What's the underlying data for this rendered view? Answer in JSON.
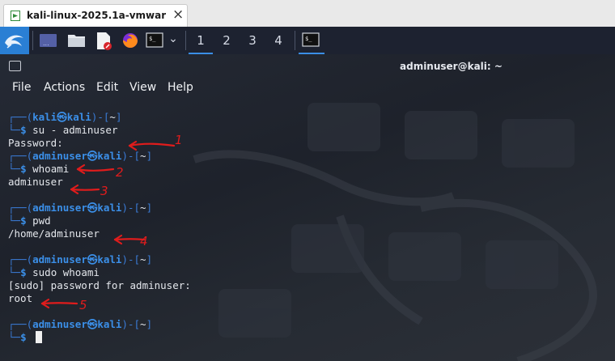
{
  "host": {
    "tab_title": "kali-linux-2025.1a-vmwar",
    "close_glyph": "×"
  },
  "panel": {
    "workspaces": [
      "1",
      "2",
      "3",
      "4"
    ],
    "chevron": "⌄"
  },
  "terminal": {
    "title": "adminuser@kali: ~",
    "menu": [
      "File",
      "Actions",
      "Edit",
      "View",
      "Help"
    ],
    "prompts": [
      {
        "user": "kali",
        "host": "kali",
        "path": "~",
        "command": "su - adminuser",
        "output": [
          "Password:"
        ]
      },
      {
        "user": "adminuser",
        "host": "kali",
        "path": "~",
        "command": "whoami",
        "output": [
          "adminuser"
        ]
      },
      {
        "user": "adminuser",
        "host": "kali",
        "path": "~",
        "command": "pwd",
        "output": [
          "/home/adminuser"
        ]
      },
      {
        "user": "adminuser",
        "host": "kali",
        "path": "~",
        "command": "sudo whoami",
        "output": [
          "[sudo] password for adminuser:",
          "root"
        ]
      },
      {
        "user": "adminuser",
        "host": "kali",
        "path": "~",
        "command": "",
        "output": []
      }
    ],
    "prompt_symbol": "$",
    "at_symbol": "㉿"
  },
  "annotations": [
    "1",
    "2",
    "3",
    "4",
    "5"
  ],
  "colors": {
    "accent": "#3b8fe8",
    "annotation": "#e01c1c"
  }
}
